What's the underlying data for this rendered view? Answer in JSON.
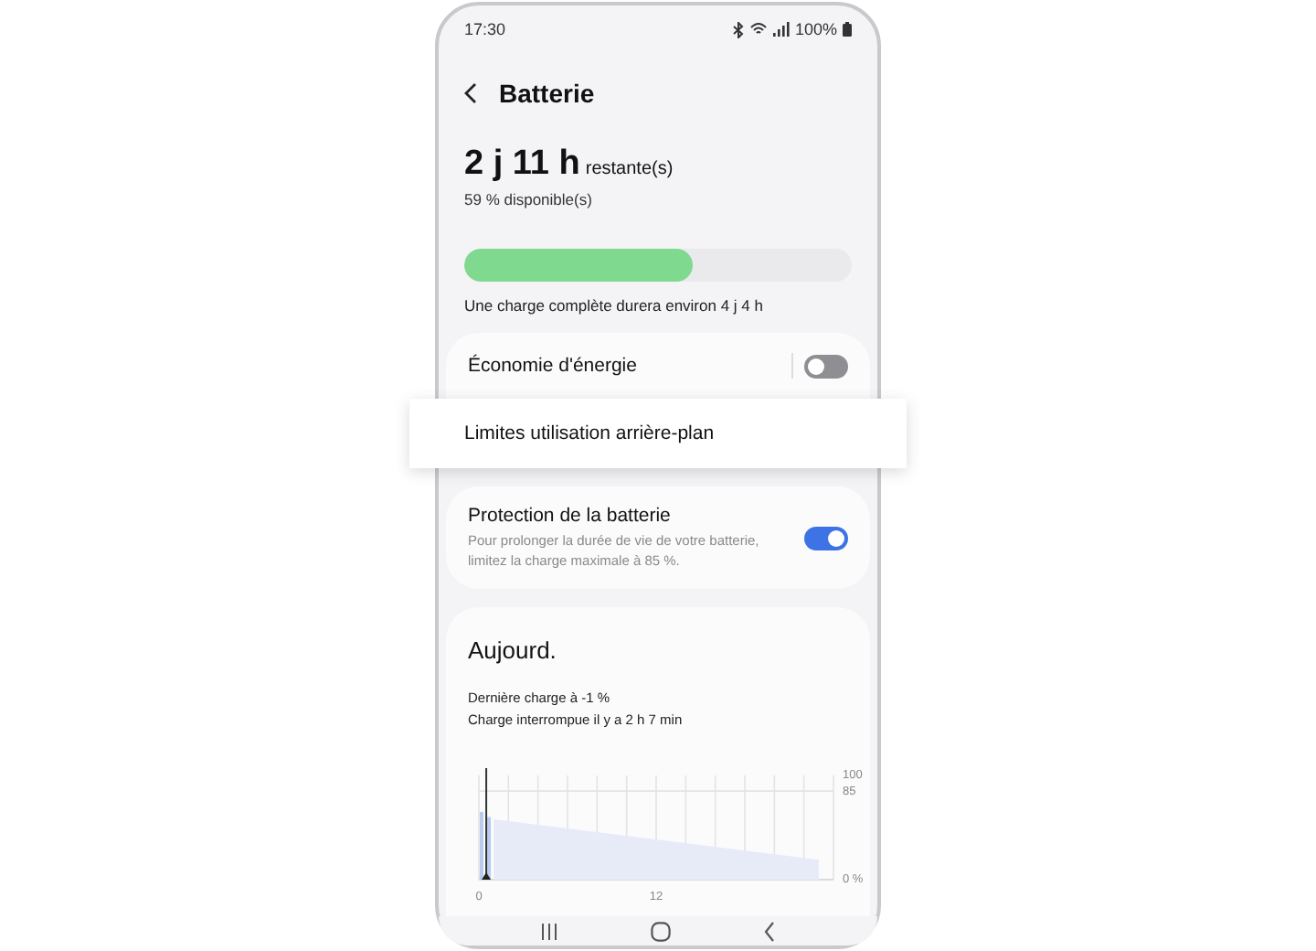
{
  "status_bar": {
    "time": "17:30",
    "battery": "100%"
  },
  "header": {
    "title": "Batterie"
  },
  "summary": {
    "remaining": "2 j 11 h",
    "remaining_suffix": "restante(s)",
    "available": "59 % disponible(s)",
    "level": 0.59,
    "full_charge": "Une charge complète durera environ 4 j 4 h"
  },
  "settings": [
    {
      "kind": "toggle",
      "label": "Économie d'énergie",
      "on": false,
      "highlighted": false
    },
    {
      "kind": "link",
      "label": "Limites utilisation arrière-plan",
      "highlighted": true
    }
  ],
  "protection": {
    "label": "Protection de la batterie",
    "description": "Pour prolonger la durée de vie de votre batterie, limitez la charge maximale à 85 %.",
    "on": true
  },
  "today": {
    "title": "Aujourd.",
    "lines": [
      "Dernière charge à -1 %",
      "Charge interrompue il y a 2 h 7 min"
    ],
    "chart_data": {
      "type": "area",
      "x": [
        0,
        0.5,
        1,
        23
      ],
      "xlim": [
        0,
        24
      ],
      "ylim": [
        0,
        100
      ],
      "xticks": [
        0,
        12
      ],
      "ref_lines": [
        {
          "axis": "x",
          "value": 0.5
        }
      ],
      "yticks": [
        {
          "value": 100,
          "label": "100"
        },
        {
          "value": 85,
          "label": "85"
        },
        {
          "value": 0,
          "label": "0 %"
        }
      ],
      "series": [
        {
          "color": "#e6ebf7",
          "values": [
            null,
            null,
            58,
            19
          ]
        },
        {
          "color": "#b9cbee",
          "values": [
            65,
            60,
            null,
            null
          ]
        }
      ]
    }
  }
}
